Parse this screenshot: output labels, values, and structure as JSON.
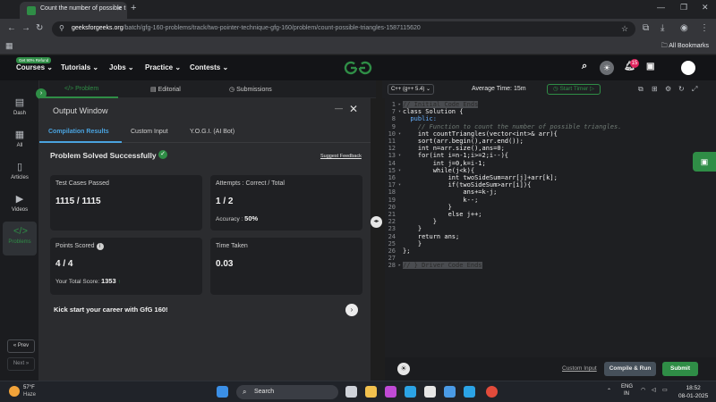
{
  "browser": {
    "tab_title": "Count the number of possible t",
    "address_site": "geeksforgeeks.org",
    "address_path": "/batch/gfg-160-problems/track/two-pointer-technique-gfg-160/problem/count-possible-triangles-1587115620",
    "all_bookmarks": "All Bookmarks"
  },
  "nav": {
    "promo": "Get 90% Refund",
    "items": [
      "Courses",
      "Tutorials",
      "Jobs",
      "Practice",
      "Contests"
    ],
    "logo": "GfG",
    "notification_count": "15"
  },
  "sidebar": {
    "items": [
      {
        "label": "Dash",
        "icon": "dashboard-icon"
      },
      {
        "label": "All",
        "icon": "grid-icon"
      },
      {
        "label": "Articles",
        "icon": "article-icon"
      },
      {
        "label": "Videos",
        "icon": "video-icon"
      },
      {
        "label": "Problems",
        "icon": "code-icon"
      }
    ],
    "prev": "« Prev",
    "next": "Next »"
  },
  "problem_tabs": [
    "Problem",
    "Editorial",
    "Submissions"
  ],
  "output": {
    "title": "Output Window",
    "tabs": [
      "Compilation Results",
      "Custom Input",
      "Y.O.G.I. (AI Bot)"
    ],
    "status": "Problem Solved Successfully",
    "suggest_feedback": "Suggest Feedback",
    "test_cases_label": "Test Cases Passed",
    "test_cases_value": "1115 / 1115",
    "attempts_label": "Attempts : Correct / Total",
    "attempts_value": "1 / 2",
    "accuracy_label": "Accuracy :",
    "accuracy_value": "50%",
    "points_label": "Points Scored",
    "points_value": "4 / 4",
    "total_score_label": "Your Total Score:",
    "total_score_value": "1353",
    "time_label": "Time Taken",
    "time_value": "0.03",
    "kickstart": "Kick start your career with GfG 160!"
  },
  "editor": {
    "language": "C++ (g++ 5.4)",
    "avg_time": "Average Time: 15m",
    "start_timer": "Start Timer",
    "lines": [
      {
        "n": "1",
        "text": "// Initial Code Ends",
        "cls": "hl",
        "fold": "▸"
      },
      {
        "n": "7",
        "text": "class Solution {",
        "cls": "",
        "fold": "▾"
      },
      {
        "n": "8",
        "text": "  public:",
        "cls": "kw",
        "fold": ""
      },
      {
        "n": "9",
        "text": "    // Function to count the number of possible triangles.",
        "cls": "cmt",
        "fold": ""
      },
      {
        "n": "10",
        "text": "    int countTriangles(vector<int>& arr){",
        "cls": "",
        "fold": "▾"
      },
      {
        "n": "11",
        "text": "    sort(arr.begin(),arr.end());",
        "cls": "",
        "fold": ""
      },
      {
        "n": "12",
        "text": "    int n=arr.size(),ans=0;",
        "cls": "",
        "fold": ""
      },
      {
        "n": "13",
        "text": "    for(int i=n-1;i>=2;i--){",
        "cls": "",
        "fold": "▾"
      },
      {
        "n": "14",
        "text": "        int j=0,k=i-1;",
        "cls": "",
        "fold": ""
      },
      {
        "n": "15",
        "text": "        while(j<k){",
        "cls": "",
        "fold": "▾"
      },
      {
        "n": "16",
        "text": "            int twoSideSum=arr[j]+arr[k];",
        "cls": "",
        "fold": ""
      },
      {
        "n": "17",
        "text": "            if(twoSideSum>arr[i]){",
        "cls": "",
        "fold": "▾"
      },
      {
        "n": "18",
        "text": "                ans+=k-j;",
        "cls": "",
        "fold": ""
      },
      {
        "n": "19",
        "text": "                k--;",
        "cls": "",
        "fold": ""
      },
      {
        "n": "20",
        "text": "            }",
        "cls": "",
        "fold": ""
      },
      {
        "n": "21",
        "text": "            else j++;",
        "cls": "",
        "fold": ""
      },
      {
        "n": "22",
        "text": "        }",
        "cls": "",
        "fold": ""
      },
      {
        "n": "23",
        "text": "    }",
        "cls": "",
        "fold": ""
      },
      {
        "n": "24",
        "text": "    return ans;",
        "cls": "",
        "fold": ""
      },
      {
        "n": "25",
        "text": "    }",
        "cls": "",
        "fold": ""
      },
      {
        "n": "26",
        "text": "};",
        "cls": "",
        "fold": ""
      },
      {
        "n": "27",
        "text": "",
        "cls": "",
        "fold": ""
      },
      {
        "n": "28",
        "text": "// } Driver Code Ends",
        "cls": "hl",
        "fold": "▸"
      }
    ],
    "custom_input": "Custom Input",
    "compile_run": "Compile & Run",
    "submit": "Submit"
  },
  "taskbar": {
    "temp": "57°F",
    "weather": "Haze",
    "search": "Search",
    "lang": "ENG",
    "region": "IN",
    "time": "18:52",
    "date": "08-01-2025"
  },
  "colors": {
    "accent_green": "#2f8d46",
    "link_blue": "#4aa3df",
    "badge_red": "#e0245e"
  }
}
